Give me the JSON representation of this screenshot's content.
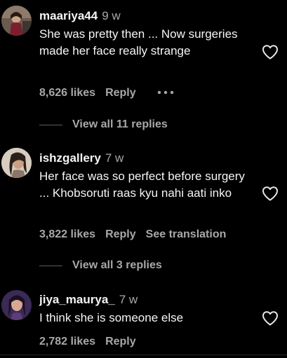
{
  "comments": [
    {
      "username": "maariya44",
      "age": "9 w",
      "text": "She was pretty then ... Now surgeries made her face really strange",
      "likes": "8,626 likes",
      "reply_label": "Reply",
      "replies_label": "View all 11 replies",
      "avatar_icon": "user-avatar-photo",
      "like_icon": "heart-outline-icon",
      "more_icon": "more-horizontal-icon"
    },
    {
      "username": "ishzgallery",
      "age": "7 w",
      "text": "Her face was so perfect before surgery ... Khobsoruti raas kyu nahi aati inko",
      "likes": "3,822 likes",
      "reply_label": "Reply",
      "translate_label": "See translation",
      "replies_label": "View all 3 replies",
      "avatar_icon": "user-avatar-photo",
      "like_icon": "heart-outline-icon"
    },
    {
      "username": "jiya_maurya_",
      "age": "7 w",
      "text": "I think she is someone else",
      "likes": "2,782 likes",
      "reply_label": "Reply",
      "avatar_icon": "user-avatar-photo",
      "like_icon": "heart-outline-icon"
    }
  ],
  "colors": {
    "background": "#000000",
    "primary_text": "#f5f5f5",
    "secondary_text": "#a8a8a8",
    "divider": "#5c5c5c"
  }
}
